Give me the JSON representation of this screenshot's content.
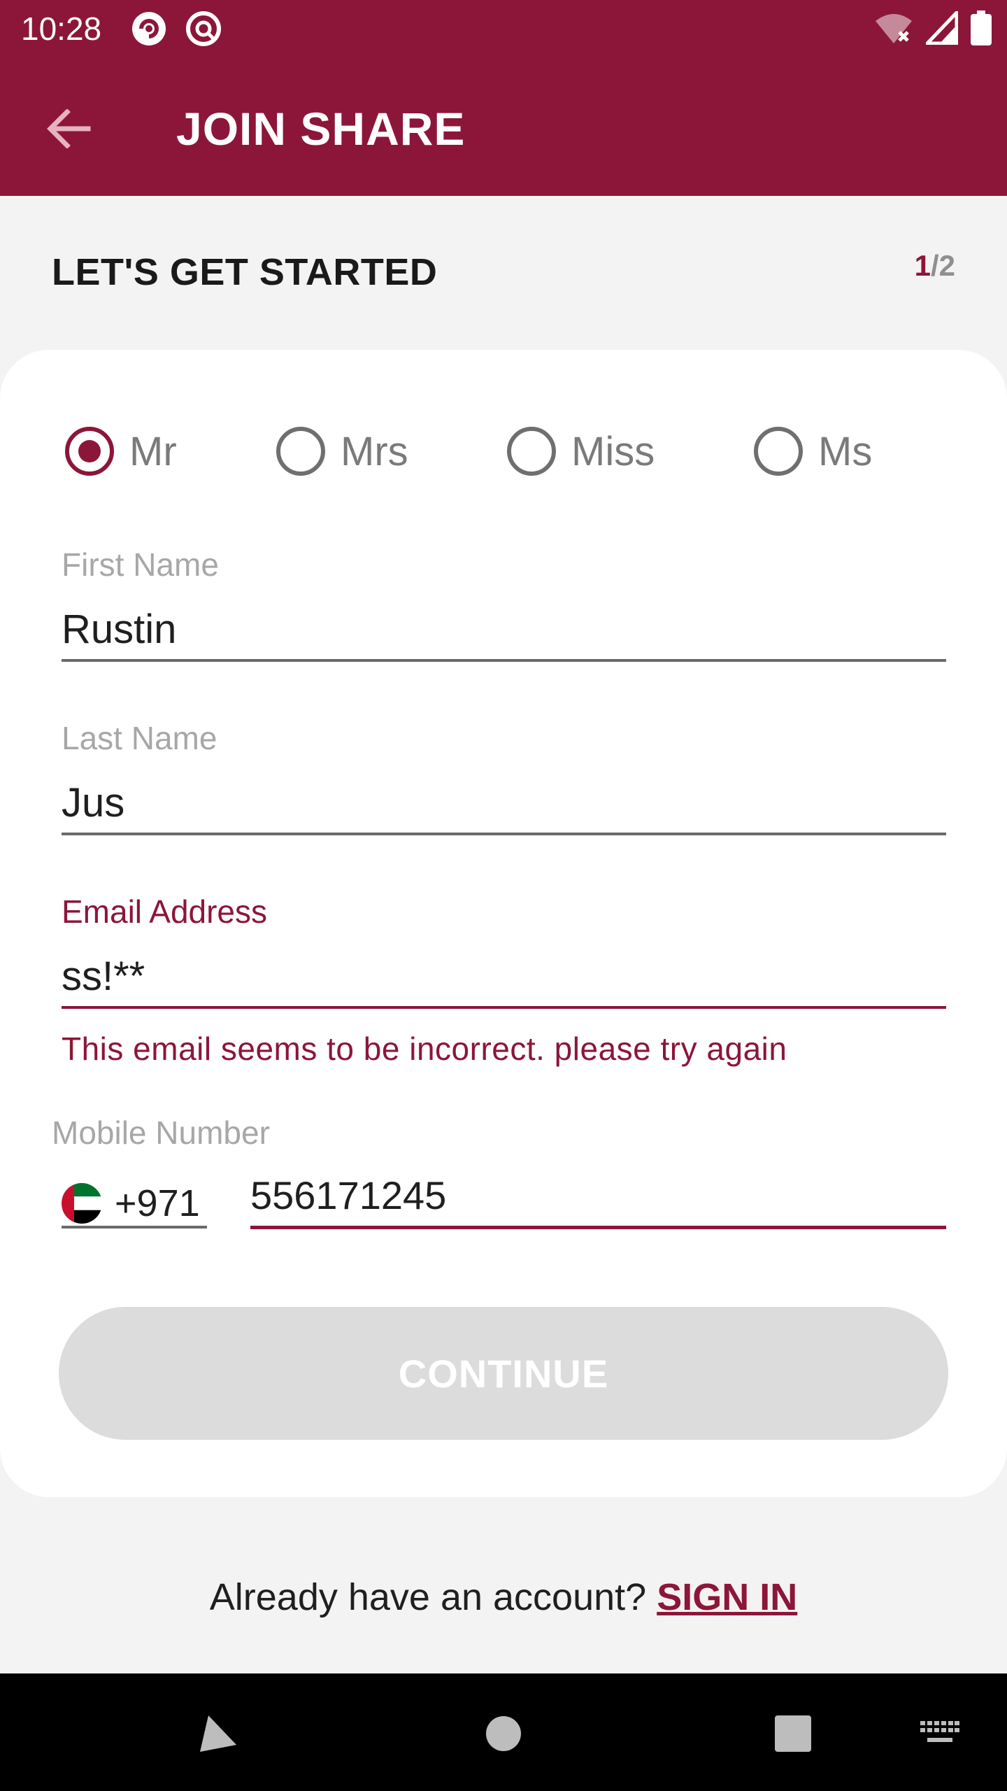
{
  "status_bar": {
    "time": "10:28"
  },
  "app_bar": {
    "title": "JOIN SHARE"
  },
  "header": {
    "section_title": "LET'S GET STARTED",
    "step_current": "1",
    "step_total": "/2"
  },
  "title_options": [
    {
      "label": "Mr",
      "selected": true
    },
    {
      "label": "Mrs",
      "selected": false
    },
    {
      "label": "Miss",
      "selected": false
    },
    {
      "label": "Ms",
      "selected": false
    }
  ],
  "fields": {
    "first_name": {
      "label": "First Name",
      "value": "Rustin"
    },
    "last_name": {
      "label": "Last Name",
      "value": "Jus"
    },
    "email": {
      "label": "Email Address",
      "value": "ss!**",
      "error": "This email seems to be incorrect. please try again"
    },
    "mobile": {
      "label": "Mobile Number",
      "country_code": "+971",
      "value": "556171245"
    }
  },
  "continue_button": {
    "label": "CONTINUE",
    "enabled": false
  },
  "footer": {
    "prompt": "Already have an account? ",
    "link": "SIGN IN"
  },
  "colors": {
    "brand": "#8c1639",
    "background": "#f3f3f3",
    "disabled_button": "#dcdcdc"
  }
}
